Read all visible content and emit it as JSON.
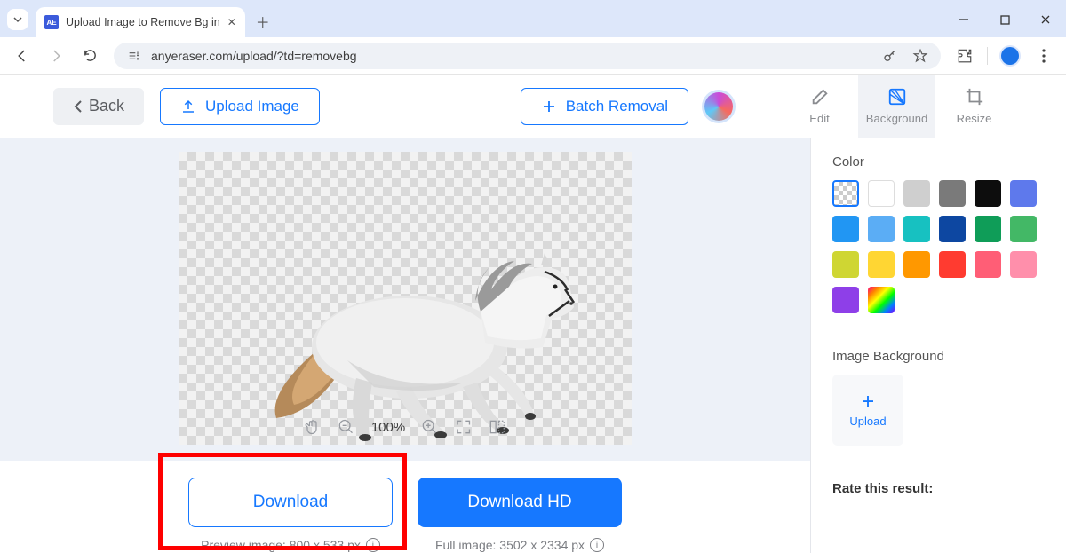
{
  "browser": {
    "tab_title": "Upload Image to Remove Bg in",
    "url": "anyeraser.com/upload/?td=removebg",
    "favicon_text": "AE"
  },
  "header": {
    "back": "Back",
    "upload": "Upload Image",
    "batch": "Batch Removal",
    "tools": [
      {
        "label": "Edit"
      },
      {
        "label": "Background"
      },
      {
        "label": "Resize"
      }
    ]
  },
  "canvas": {
    "zoom": "100%"
  },
  "download": {
    "std_label": "Download",
    "hd_label": "Download HD",
    "preview_text": "Preview image: 800 x 533 px",
    "full_text": "Full image: 3502 x 2334 px"
  },
  "sidebar": {
    "color_h": "Color",
    "imgbg_h": "Image Background",
    "upload_label": "Upload",
    "rate_h": "Rate this result:",
    "swatches": [
      "trans",
      "white",
      "#cfcfcf",
      "#7a7a7a",
      "#0d0d0d",
      "#5e79ec",
      "#2196f3",
      "#5badf5",
      "#17c1c1",
      "#0d47a1",
      "#0f9d58",
      "#43b866",
      "#cfd633",
      "#ffd633",
      "#ff9800",
      "#ff3b30",
      "#ff5e76",
      "#ff8fab",
      "#8e3fe8",
      "rainbow"
    ]
  }
}
